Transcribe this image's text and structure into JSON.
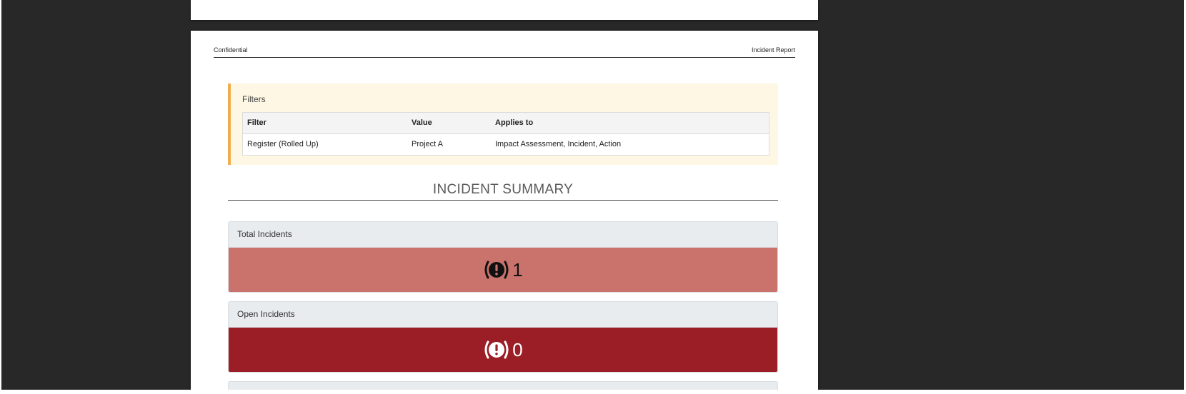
{
  "page_header": {
    "left": "Confidential",
    "right": "Incident Report"
  },
  "filters": {
    "title": "Filters",
    "columns": [
      "Filter",
      "Value",
      "Applies to"
    ],
    "rows": [
      [
        "Register (Rolled Up)",
        "Project A",
        "Impact Assessment, Incident, Action"
      ]
    ]
  },
  "summary": {
    "title": "INCIDENT SUMMARY",
    "cards": [
      {
        "label": "Total Incidents",
        "value": "1",
        "icon": "alert-icon",
        "bg_color": "#c9736c",
        "text_color": "#111111"
      },
      {
        "label": "Open Incidents",
        "value": "0",
        "icon": "alert-icon",
        "bg_color": "#9b1e27",
        "text_color": "#ffffff"
      }
    ]
  },
  "colors": {
    "viewer_background": "#282828",
    "filters_background": "#fdf7e3",
    "filters_accent": "#f0ad4e",
    "card_header": "#e9ecef"
  }
}
